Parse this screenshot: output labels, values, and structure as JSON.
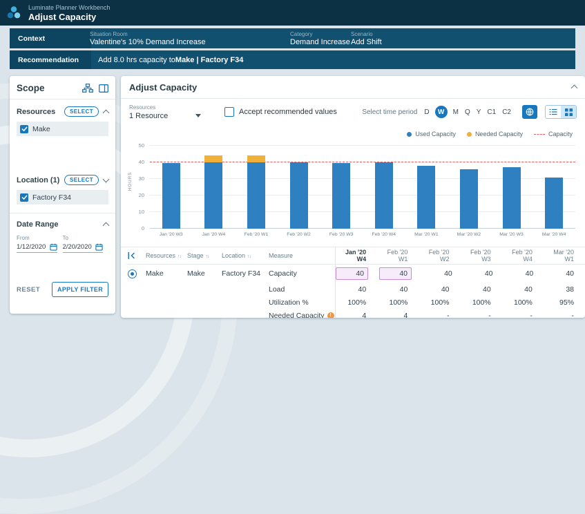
{
  "app": {
    "suite": "Luminate Planner Workbench",
    "page_title": "Adjust Capacity"
  },
  "context_bar": {
    "label": "Context",
    "fields": [
      {
        "label": "Situation Room",
        "value": "Valentine's 10% Demand Increase"
      },
      {
        "label": "Category",
        "value": "Demand Increase"
      },
      {
        "label": "Scenario",
        "value": "Add Shift"
      }
    ]
  },
  "recommendation_bar": {
    "label": "Recommendation",
    "text_prefix": "Add 8.0 hrs capacity to ",
    "text_bold": "Make | Factory F34"
  },
  "scope": {
    "title": "Scope",
    "resources": {
      "label": "Resources",
      "select_label": "SELECT",
      "items": [
        {
          "label": "Make",
          "checked": true
        }
      ]
    },
    "location": {
      "label": "Location (1)",
      "select_label": "SELECT",
      "items": [
        {
          "label": "Factory F34",
          "checked": true
        }
      ]
    },
    "date_range": {
      "label": "Date Range",
      "from_label": "From",
      "to_label": "To",
      "from_value": "1/12/2020",
      "to_value": "2/20/2020"
    },
    "reset_label": "RESET",
    "apply_label": "APPLY FILTER"
  },
  "main": {
    "title": "Adjust Capacity",
    "resources_label": "Resources",
    "resources_value": "1 Resource",
    "accept_label": "Accept recommended values",
    "time_period_label": "Select time period",
    "time_periods": [
      "D",
      "W",
      "M",
      "Q",
      "Y",
      "C1",
      "C2"
    ],
    "time_period_selected": "W"
  },
  "chart_data": {
    "type": "bar",
    "title": "",
    "xlabel": "",
    "ylabel": "HOURS",
    "ylim": [
      0,
      50
    ],
    "yticks": [
      0,
      10,
      20,
      30,
      40,
      50
    ],
    "categories": [
      "Jan '20 W3",
      "Jan '20 W4",
      "Feb '20 W1",
      "Feb '20 W2",
      "Feb '20 W3",
      "Feb '20 W4",
      "Mar '20 W1",
      "Mar '20 W2",
      "Mar '20 W3",
      "Mar '20 W4"
    ],
    "series": [
      {
        "name": "Used Capacity",
        "color": "#2e80c0",
        "values": [
          39.5,
          40,
          40,
          40,
          39.5,
          40,
          38,
          36,
          37,
          31
        ]
      },
      {
        "name": "Needed Capacity",
        "color": "#f0b13a",
        "values": [
          0,
          4,
          4,
          0,
          0,
          0,
          0,
          0,
          0,
          0
        ]
      }
    ],
    "reference_line": {
      "name": "Capacity",
      "value": 40,
      "color": "#e0605c",
      "style": "dashed"
    },
    "legend": [
      {
        "label": "Used Capacity",
        "color": "#2e80c0",
        "marker": "dot"
      },
      {
        "label": "Needed Capacity",
        "color": "#f0b13a",
        "marker": "dot"
      },
      {
        "label": "Capacity",
        "color": "#e0605c",
        "marker": "dashed-line"
      }
    ],
    "legend_position": "top-right",
    "grid": true
  },
  "table": {
    "meta_headers": [
      {
        "label": "Resources",
        "sortable": true
      },
      {
        "label": "Stage",
        "sortable": true
      },
      {
        "label": "Location",
        "sortable": true
      },
      {
        "label": "Measure",
        "sortable": false
      }
    ],
    "period_headers": [
      "Jan '20 W4",
      "Feb '20 W1",
      "Feb '20 W2",
      "Feb '20 W3",
      "Feb '20 W4",
      "Mar '20 W1"
    ],
    "highlighted_period": "Jan '20 W4",
    "group": {
      "resource": "Make",
      "stage": "Make",
      "location": "Factory F34",
      "selected": true
    },
    "rows": [
      {
        "measure": "Capacity",
        "values": [
          "40",
          "40",
          "40",
          "40",
          "40",
          "40"
        ],
        "editable": [
          true,
          true,
          false,
          false,
          false,
          false
        ]
      },
      {
        "measure": "Load",
        "values": [
          "40",
          "40",
          "40",
          "40",
          "40",
          "38"
        ]
      },
      {
        "measure": "Utilization %",
        "values": [
          "100%",
          "100%",
          "100%",
          "100%",
          "100%",
          "95%"
        ]
      },
      {
        "measure": "Needed Capacity",
        "warning": true,
        "values": [
          "4",
          "4",
          "-",
          "-",
          "-",
          "-"
        ]
      }
    ]
  },
  "icons": {
    "logo": "three-petal-logo",
    "scope": [
      "sitemap-icon",
      "side-panel-icon"
    ],
    "dates": "calendar-icon",
    "view_buttons": [
      "globe-icon",
      "list-icon",
      "grid-icon"
    ],
    "table": [
      "collapse-left-icon",
      "sort-icon",
      "warning-icon"
    ]
  },
  "colors": {
    "accent": "#1878be",
    "topbar": "#0c3044",
    "infobar": "#12506f",
    "bar_used": "#2e80c0",
    "bar_needed": "#f0b13a",
    "capacity_line": "#e0605c",
    "edit_cell_bg": "#f7ecf9",
    "edit_cell_border": "#c98bd6"
  }
}
